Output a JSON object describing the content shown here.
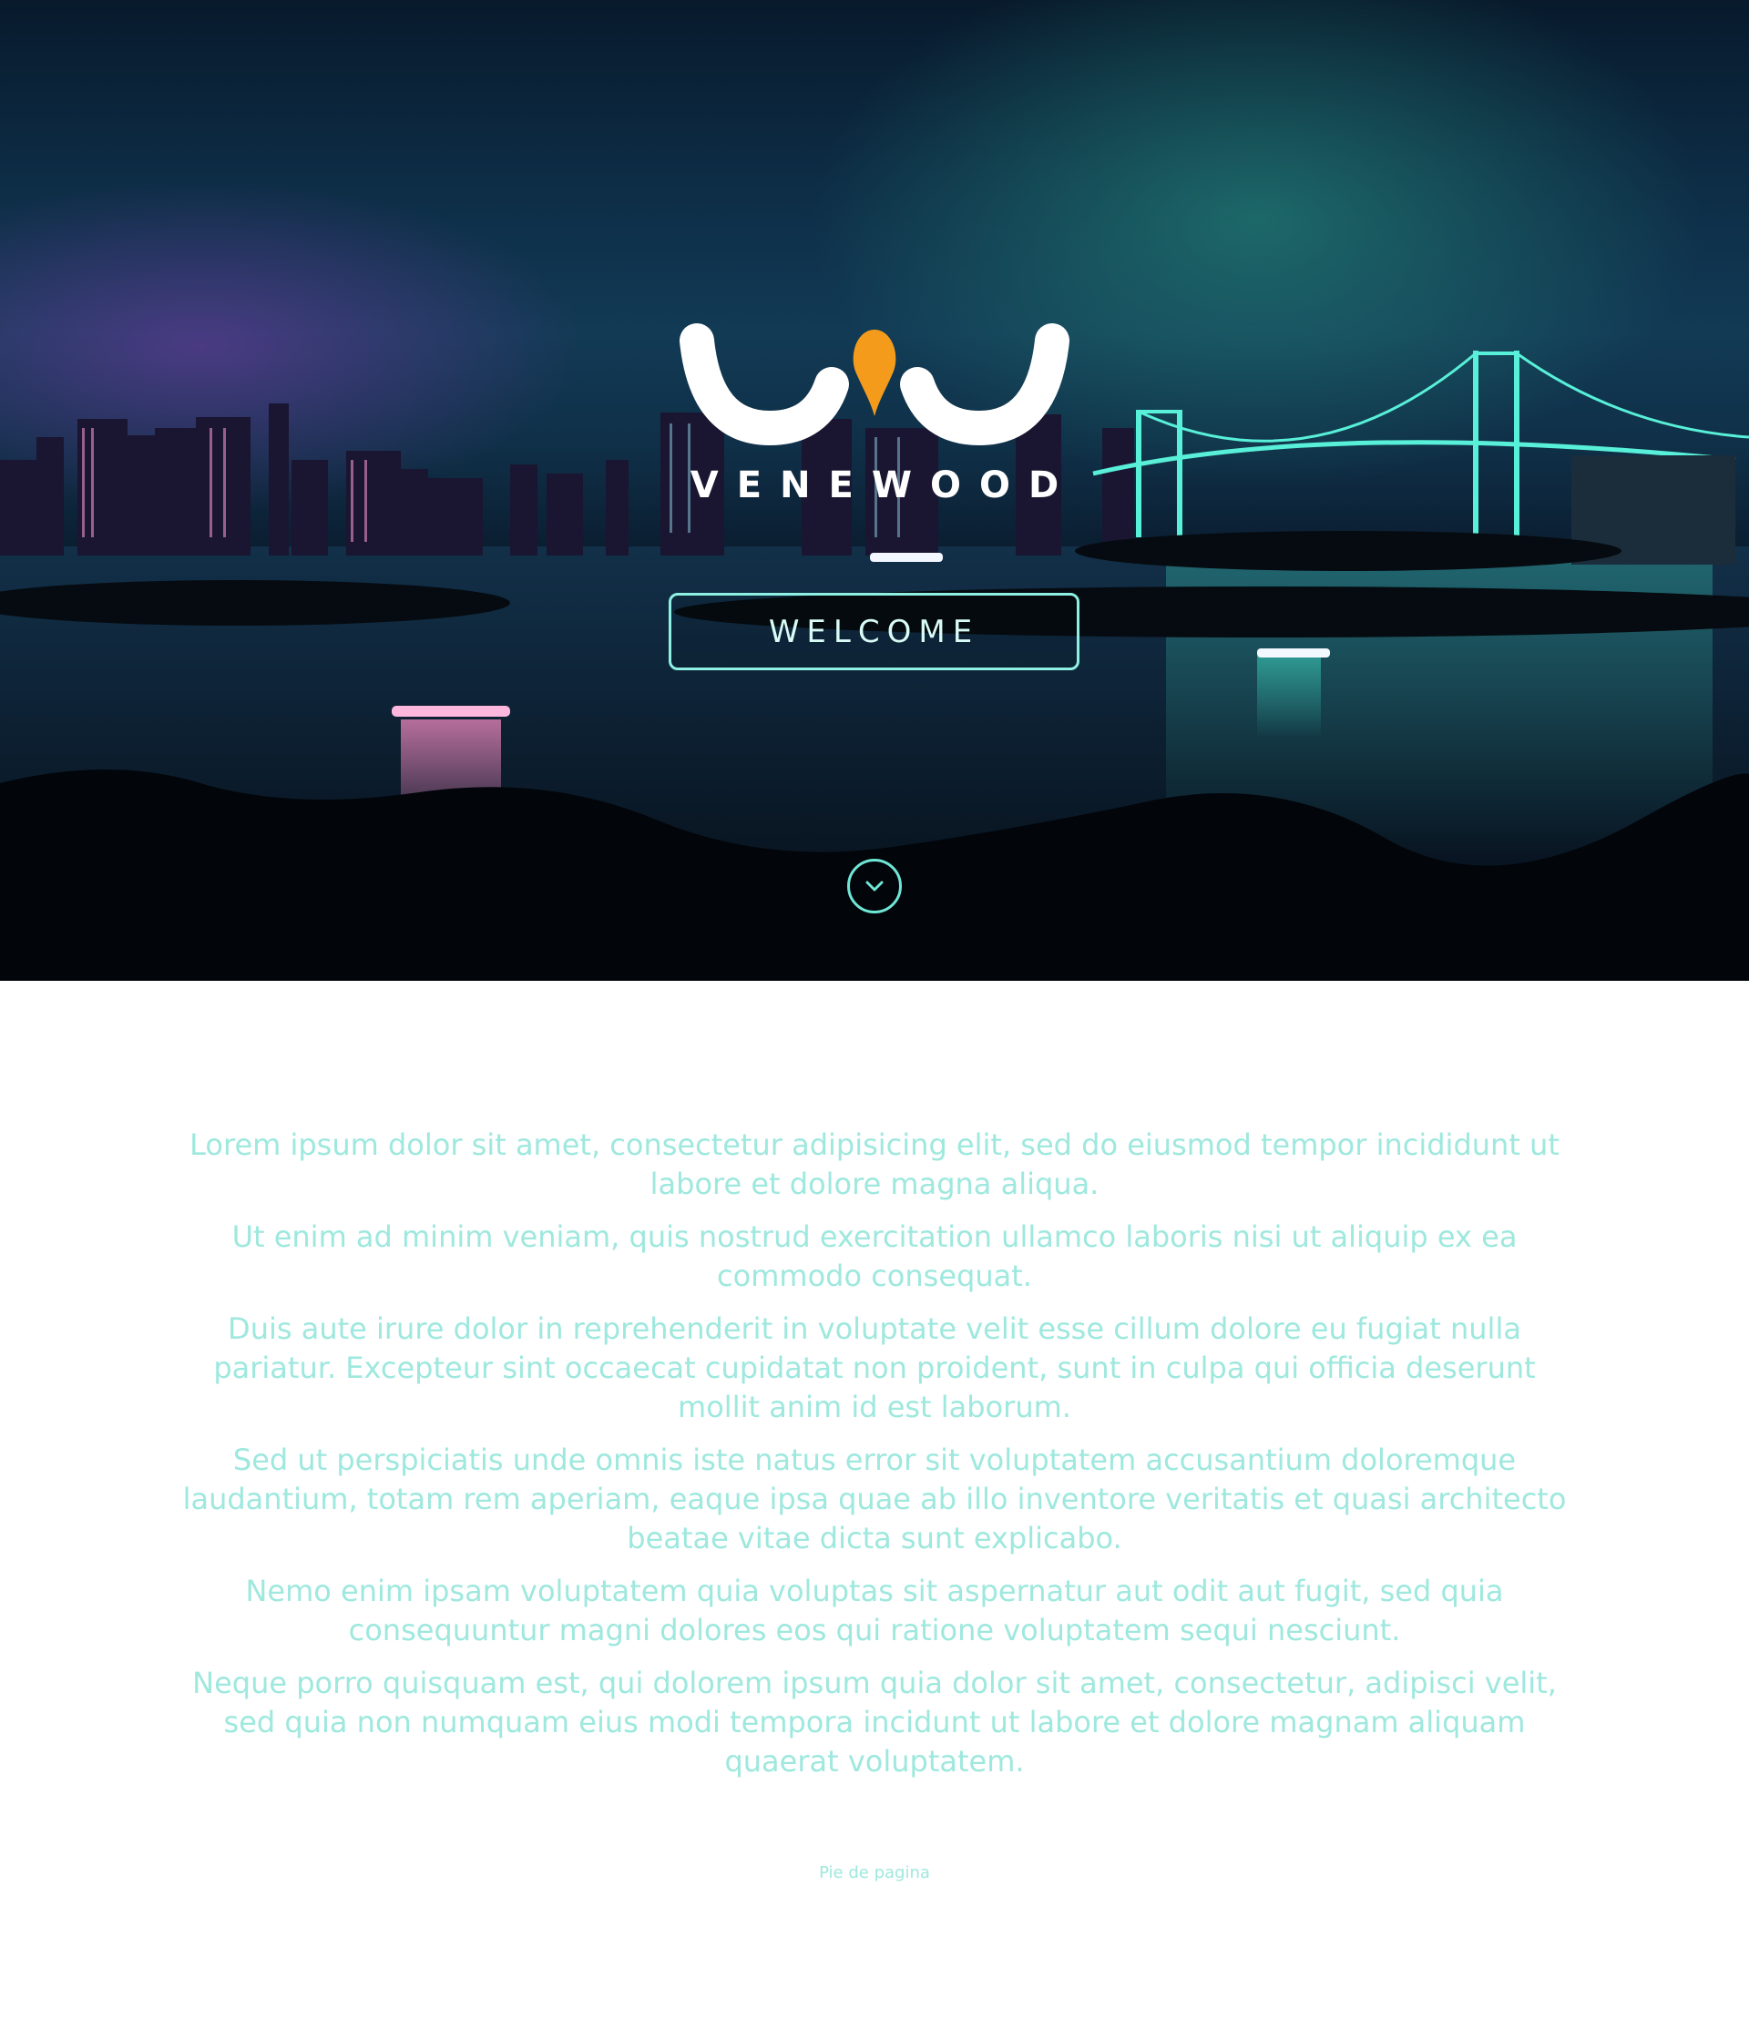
{
  "hero": {
    "brand_name": "VENEWOOD",
    "welcome_label": "WELCOME"
  },
  "content": {
    "paragraphs": [
      "Lorem ipsum dolor sit amet, consectetur adipisicing elit, sed do eiusmod tempor incididunt ut labore et dolore magna aliqua.",
      "Ut enim ad minim veniam, quis nostrud exercitation ullamco laboris nisi ut aliquip ex ea commodo consequat.",
      "Duis aute irure dolor in reprehenderit in voluptate velit esse cillum dolore eu fugiat nulla pariatur. Excepteur sint occaecat cupidatat non proident, sunt in culpa qui officia deserunt mollit anim id est laborum.",
      "Sed ut perspiciatis unde omnis iste natus error sit voluptatem accusantium doloremque laudantium, totam rem aperiam, eaque ipsa quae ab illo inventore veritatis et quasi architecto beatae vitae dicta sunt explicabo.",
      "Nemo enim ipsam voluptatem quia voluptas sit aspernatur aut odit aut fugit, sed quia consequuntur magni dolores eos qui ratione voluptatem sequi nesciunt.",
      "Neque porro quisquam est, qui dolorem ipsum quia dolor sit amet, consectetur, adipisci velit, sed quia non numquam eius modi tempora incidunt ut labore et dolore magnam aliquam quaerat voluptatem."
    ]
  },
  "footer": {
    "text": "Pie de pagina"
  },
  "colors": {
    "accent": "#9ee8de",
    "button_border": "#8ef0e3",
    "logo_drop": "#f59b1c"
  },
  "icons": {
    "scroll": "chevron-down-icon"
  }
}
